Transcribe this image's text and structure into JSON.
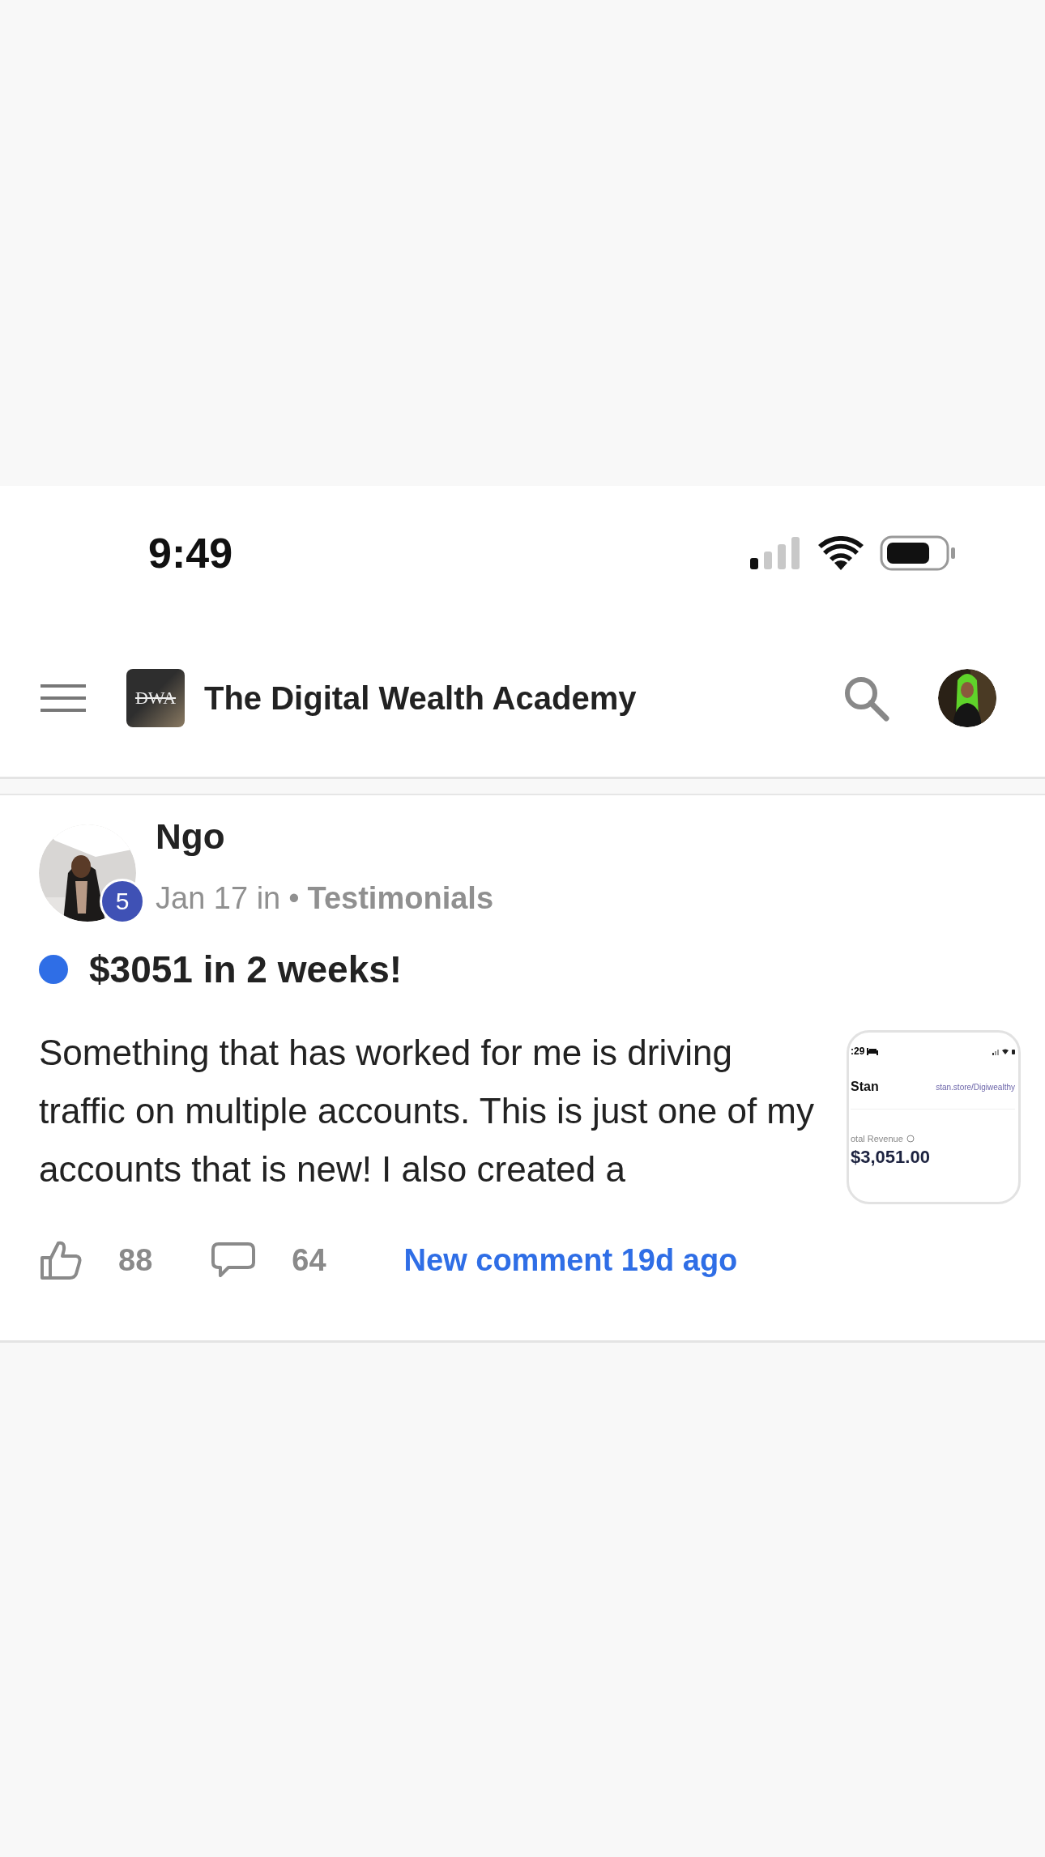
{
  "status_bar": {
    "time": "9:49"
  },
  "header": {
    "logo_text": "DWA",
    "title": "The Digital Wealth Academy"
  },
  "post": {
    "author": "Ngo",
    "level": "5",
    "date": "Jan 17 in",
    "separator": "•",
    "category": "Testimonials",
    "unread": true,
    "title": "$3051 in 2 weeks!",
    "body": "Something that has worked for me is driving traffic on multiple accounts. This is just one of my accounts that is new! I also created a",
    "thumbnail": {
      "time": ":29",
      "brand": "Stan",
      "url": "stan.store/Digiwealthy",
      "label": "otal Revenue",
      "amount": "$3,051.00"
    },
    "likes": "88",
    "comments": "64",
    "last_comment": "New comment 19d ago"
  }
}
